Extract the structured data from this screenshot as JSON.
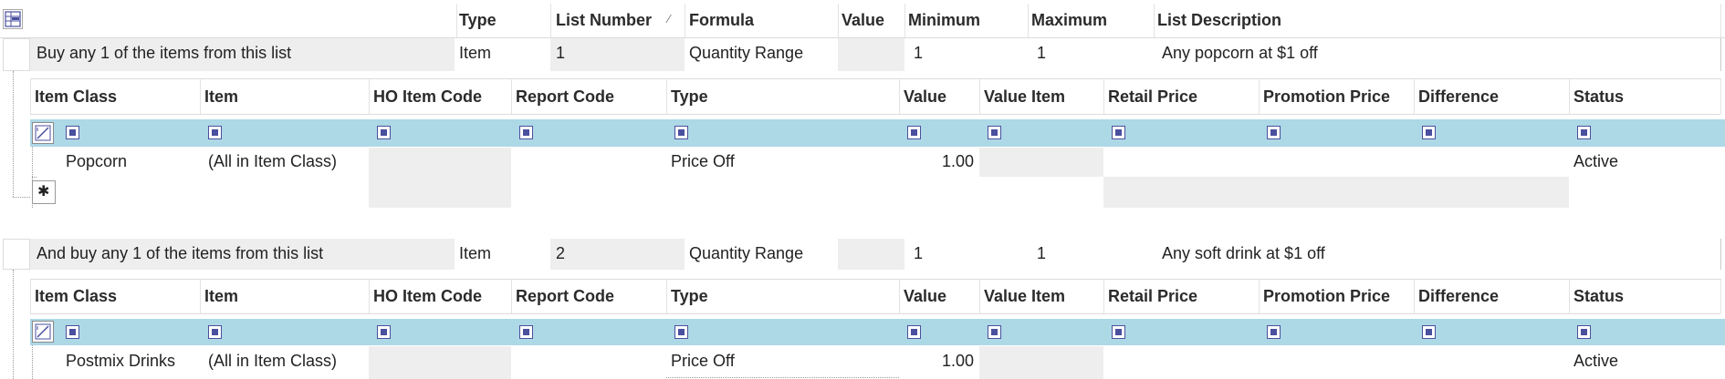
{
  "main_header": {
    "type": "Type",
    "list_number": "List Number",
    "sort_glyph": "⁄",
    "formula": "Formula",
    "value": "Value",
    "minimum": "Minimum",
    "maximum": "Maximum",
    "list_description": "List Description"
  },
  "icons": {
    "corner": "grid-settings-icon",
    "row_check": "row-select-icon",
    "col_check": "filter-checkbox-icon",
    "new_row": "new-row-icon"
  },
  "new_row_glyph": "✱",
  "sub_header": {
    "item_class": "Item Class",
    "item": "Item",
    "ho_item_code": "HO Item Code",
    "report_code": "Report Code",
    "type": "Type",
    "value": "Value",
    "value_item": "Value Item",
    "retail_price": "Retail Price",
    "promotion_price": "Promotion Price",
    "difference": "Difference",
    "status": "Status"
  },
  "lists": [
    {
      "label": "Buy any 1 of the items from this list",
      "type": "Item",
      "list_number": "1",
      "formula": "Quantity Range",
      "value": "",
      "minimum": "1",
      "maximum": "1",
      "description": "Any popcorn at $1 off",
      "items": [
        {
          "item_class": "Popcorn",
          "item": "(All in Item Class)",
          "ho_item_code": "",
          "report_code": "",
          "type": "Price Off",
          "value": "1.00",
          "value_item": "",
          "retail_price": "",
          "promotion_price": "",
          "difference": "",
          "status": "Active"
        }
      ]
    },
    {
      "label": "And buy any 1 of the items from this list",
      "type": "Item",
      "list_number": "2",
      "formula": "Quantity Range",
      "value": "",
      "minimum": "1",
      "maximum": "1",
      "description": "Any soft drink  at $1 off",
      "items": [
        {
          "item_class": "Postmix Drinks",
          "item": "(All in Item Class)",
          "ho_item_code": "",
          "report_code": "",
          "type": "Price Off",
          "value": "1.00",
          "value_item": "",
          "retail_price": "",
          "promotion_price": "",
          "difference": "",
          "status": "Active"
        }
      ]
    }
  ]
}
